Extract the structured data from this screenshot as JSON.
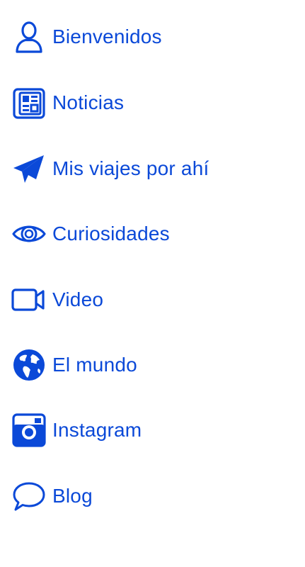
{
  "menu": {
    "items": [
      {
        "label": "Bienvenidos",
        "icon": "user-icon"
      },
      {
        "label": "Noticias",
        "icon": "newspaper-icon"
      },
      {
        "label": "Mis viajes por ahí",
        "icon": "paper-plane-icon"
      },
      {
        "label": "Curiosidades",
        "icon": "eye-icon"
      },
      {
        "label": "Video",
        "icon": "video-camera-icon"
      },
      {
        "label": "El mundo",
        "icon": "globe-icon"
      },
      {
        "label": "Instagram",
        "icon": "instagram-icon"
      },
      {
        "label": "Blog",
        "icon": "chat-bubble-icon"
      }
    ]
  },
  "colors": {
    "accent": "#0b49d8",
    "background": "#ffffff"
  }
}
